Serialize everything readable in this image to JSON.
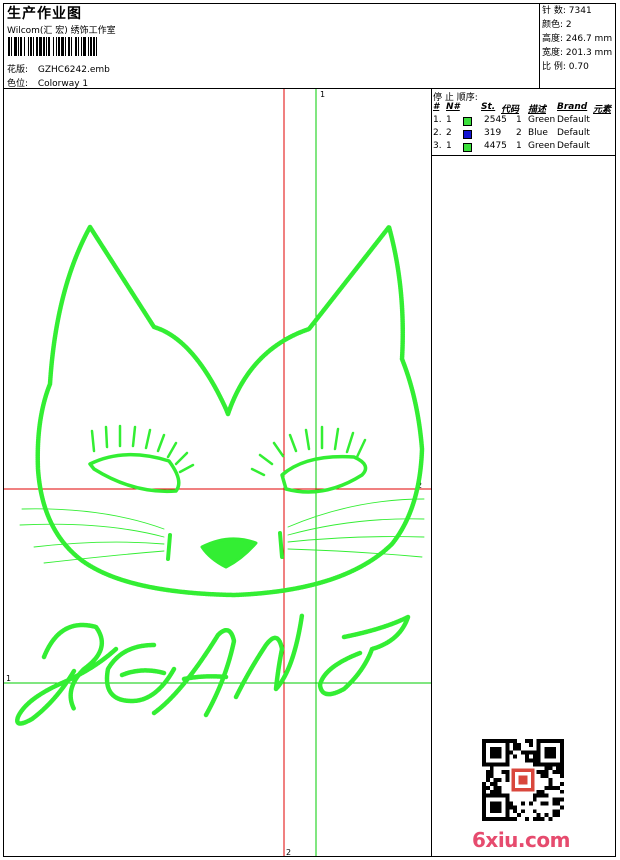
{
  "header": {
    "title": "生产作业图",
    "subtitle": "Wilcom(汇 宏) 绣饰工作室",
    "design_label": "花版:",
    "design_value": "GZHC6242.emb",
    "colorway_label": "色位:",
    "colorway_value": "Colorway 1"
  },
  "stats": {
    "stitches_label": "针 数:",
    "stitches_value": "7341",
    "colors_label": "颜色:",
    "colors_value": "2",
    "height_label": "高度:",
    "height_value": "246.7 mm",
    "width_label": "宽度:",
    "width_value": "201.3 mm",
    "scale_label": "比 例:",
    "scale_value": "0.70"
  },
  "stop_sequence": {
    "title": "停 止 顺序:",
    "headers": [
      "#",
      "N#",
      "St.",
      "代码",
      "描述",
      "Brand",
      "元素"
    ],
    "rows": [
      {
        "idx": "1.",
        "n": "1",
        "color": "#3ce03c",
        "st": "2545",
        "code": "1",
        "desc": "Green",
        "brand": "Default"
      },
      {
        "idx": "2.",
        "n": "2",
        "color": "#1414d2",
        "st": "319",
        "code": "2",
        "desc": "Blue",
        "brand": "Default"
      },
      {
        "idx": "3.",
        "n": "1",
        "color": "#3ce03c",
        "st": "4475",
        "code": "1",
        "desc": "Green",
        "brand": "Default"
      }
    ]
  },
  "guides": {
    "green_v": "1",
    "red_v": "2",
    "red_h": "2",
    "green_h": "1"
  },
  "design": {
    "text": "JEANS",
    "stitch_color": "#33ee33"
  },
  "watermark": {
    "text": "6xiu.com"
  }
}
